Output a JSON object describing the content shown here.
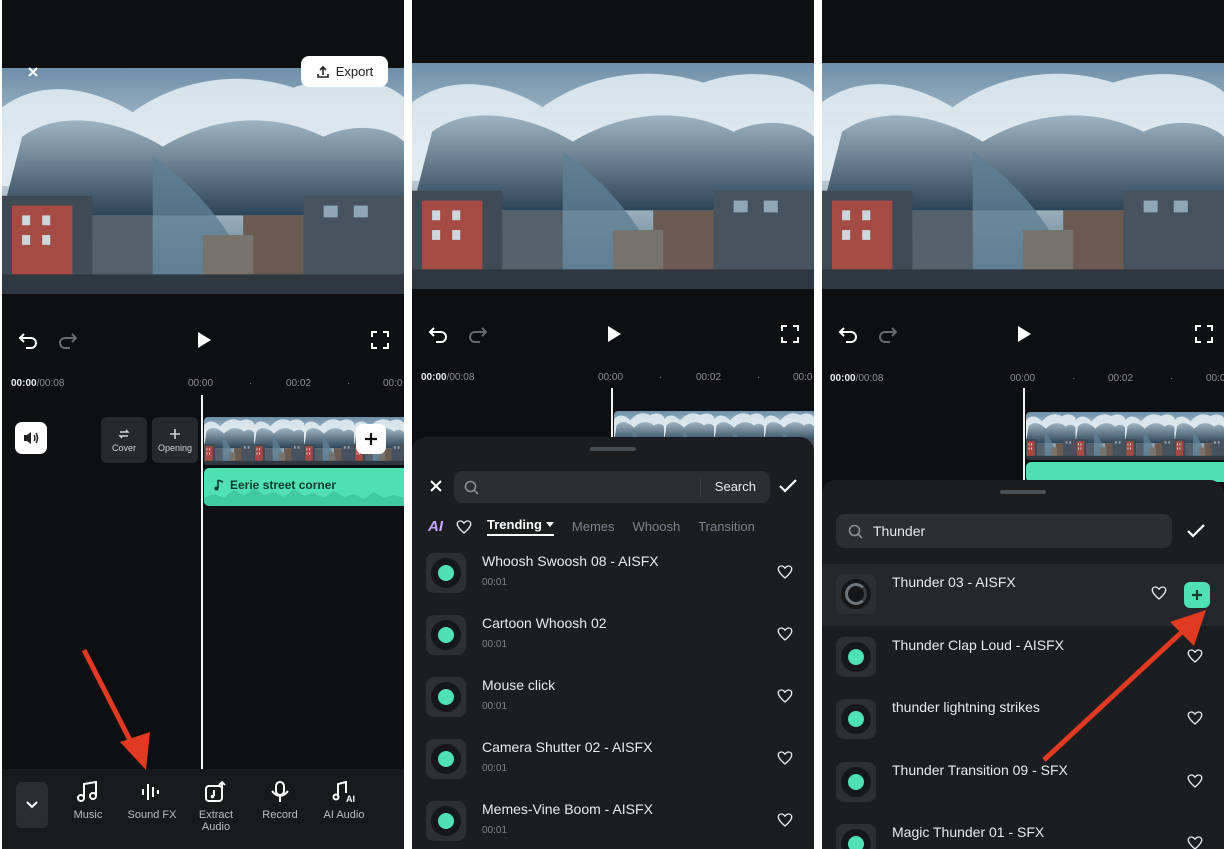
{
  "colors": {
    "accent": "#4fe0b3",
    "arrow": "#e03a22",
    "bg": "#0d0f12"
  },
  "panel1": {
    "export_label": "Export",
    "timecode_current": "00:00",
    "timecode_total": "/00:08",
    "ruler_ticks": [
      "00:00",
      "·",
      "00:02",
      "·",
      "00:0"
    ],
    "cover_label": "Cover",
    "opening_label": "Opening",
    "audio_track_label": "Eerie street corner",
    "tools": [
      {
        "label": "Music",
        "icon": "music-icon"
      },
      {
        "label": "Sound FX",
        "icon": "sound-fx-icon"
      },
      {
        "label": "Extract\nAudio",
        "icon": "extract-audio-icon"
      },
      {
        "label": "Record",
        "icon": "microphone-icon"
      },
      {
        "label": "AI Audio",
        "icon": "ai-audio-icon"
      }
    ]
  },
  "panel2": {
    "timecode_current": "00:00",
    "timecode_total": "/00:08",
    "ruler_ticks": [
      "00:00",
      "·",
      "00:02",
      "·",
      "00:0"
    ],
    "search_placeholder": "",
    "search_button": "Search",
    "ai_badge": "AI",
    "tabs": [
      "Trending",
      "Memes",
      "Whoosh",
      "Transition"
    ],
    "results": [
      {
        "title": "Whoosh Swoosh 08 - AISFX",
        "duration": "00:01"
      },
      {
        "title": "Cartoon Whoosh 02",
        "duration": "00:01"
      },
      {
        "title": "Mouse click",
        "duration": "00:01"
      },
      {
        "title": "Camera Shutter 02 - AISFX",
        "duration": "00:01"
      },
      {
        "title": "Memes-Vine Boom - AISFX",
        "duration": "00:01"
      }
    ]
  },
  "panel3": {
    "timecode_current": "00:00",
    "timecode_total": "/00:08",
    "ruler_ticks": [
      "00:00",
      "·",
      "00:02",
      "·",
      "00:0"
    ],
    "search_value": "Thunder",
    "results": [
      {
        "title": "Thunder 03 - AISFX",
        "selected": true
      },
      {
        "title": "Thunder Clap Loud - AISFX"
      },
      {
        "title": "thunder lightning strikes"
      },
      {
        "title": "Thunder Transition 09 - SFX"
      },
      {
        "title": "Magic Thunder 01 - SFX"
      }
    ]
  }
}
